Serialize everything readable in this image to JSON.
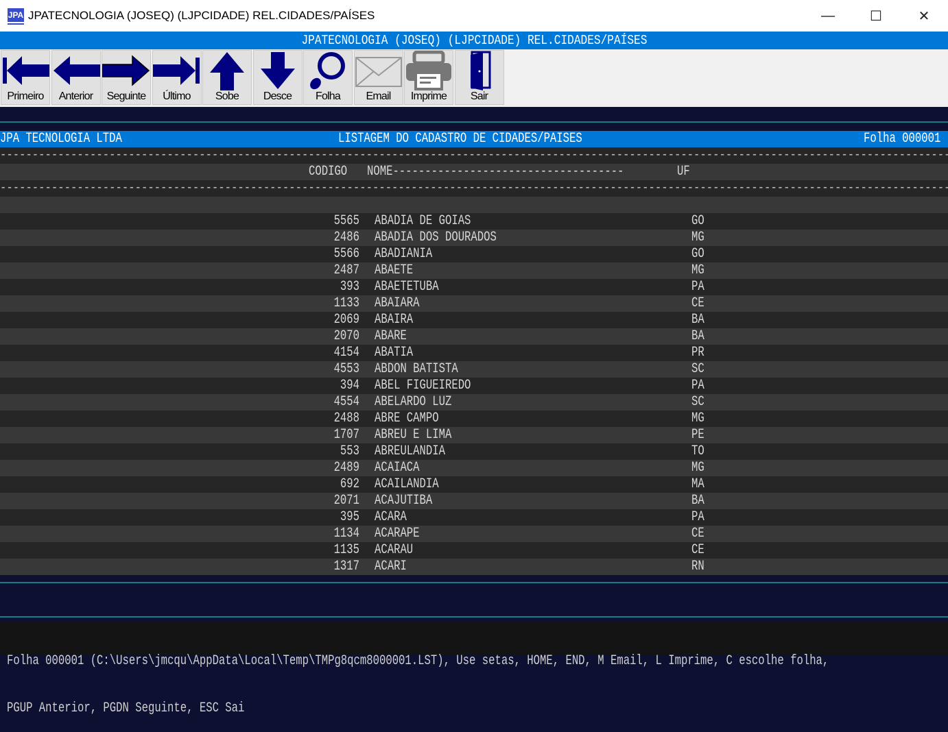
{
  "window": {
    "title": "JPATECNOLOGIA (JOSEQ) (LJPCIDADE) REL.CIDADES/PAÍSES",
    "icon_text": "JPA",
    "minimize": "—",
    "maximize": "☐",
    "close": "✕"
  },
  "app_title": "JPATECNOLOGIA (JOSEQ) (LJPCIDADE) REL.CIDADES/PAÍSES",
  "toolbar": [
    {
      "label": "Primeiro",
      "icon": "first-icon"
    },
    {
      "label": "Anterior",
      "icon": "arrow-left-icon"
    },
    {
      "label": "Seguinte",
      "icon": "arrow-right-icon"
    },
    {
      "label": "Último",
      "icon": "last-icon"
    },
    {
      "label": "Sobe",
      "icon": "arrow-up-icon"
    },
    {
      "label": "Desce",
      "icon": "arrow-down-icon"
    },
    {
      "label": "Folha",
      "icon": "magnifier-icon"
    },
    {
      "label": "Email",
      "icon": "envelope-icon"
    },
    {
      "label": "Imprime",
      "icon": "printer-icon"
    },
    {
      "label": "Sair",
      "icon": "door-icon"
    }
  ],
  "report": {
    "company": "JPA TECNOLOGIA LTDA",
    "title": "LISTAGEM DO CADASTRO DE CIDADES/PAISES",
    "page": "Folha 000001",
    "col_code": "CODIGO",
    "col_name": "NOME------------------------------------",
    "col_uf": "UF",
    "rows": [
      [
        "5565",
        "ABADIA DE GOIAS",
        "GO"
      ],
      [
        "2486",
        "ABADIA DOS DOURADOS",
        "MG"
      ],
      [
        "5566",
        "ABADIANIA",
        "GO"
      ],
      [
        "2487",
        "ABAETE",
        "MG"
      ],
      [
        "393",
        "ABAETETUBA",
        "PA"
      ],
      [
        "1133",
        "ABAIARA",
        "CE"
      ],
      [
        "2069",
        "ABAIRA",
        "BA"
      ],
      [
        "2070",
        "ABARE",
        "BA"
      ],
      [
        "4154",
        "ABATIA",
        "PR"
      ],
      [
        "4553",
        "ABDON BATISTA",
        "SC"
      ],
      [
        "394",
        "ABEL FIGUEIREDO",
        "PA"
      ],
      [
        "4554",
        "ABELARDO LUZ",
        "SC"
      ],
      [
        "2488",
        "ABRE CAMPO",
        "MG"
      ],
      [
        "1707",
        "ABREU E LIMA",
        "PE"
      ],
      [
        "553",
        "ABREULANDIA",
        "TO"
      ],
      [
        "2489",
        "ACAIACA",
        "MG"
      ],
      [
        "692",
        "ACAILANDIA",
        "MA"
      ],
      [
        "2071",
        "ACAJUTIBA",
        "BA"
      ],
      [
        "395",
        "ACARA",
        "PA"
      ],
      [
        "1134",
        "ACARAPE",
        "CE"
      ],
      [
        "1135",
        "ACARAU",
        "CE"
      ],
      [
        "1317",
        "ACARI",
        "RN"
      ]
    ]
  },
  "status": {
    "line1": "Folha 000001 (C:\\Users\\jmcqu\\AppData\\Local\\Temp\\TMPg8qcm8000001.LST), Use setas, HOME, END, M Email, L Imprime, C escolhe folha,",
    "line2": "PGUP Anterior, PGDN Seguinte, ESC Sai"
  },
  "colors": {
    "accent": "#0078d7",
    "icon": "#000080",
    "background": "#0d1030",
    "row_dark": "#262626",
    "row_light": "#383838"
  }
}
